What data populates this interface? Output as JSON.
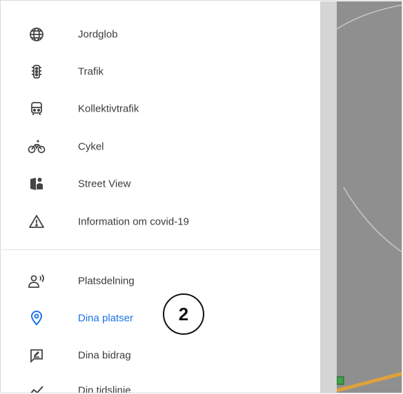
{
  "menu": {
    "items": [
      {
        "label": "Jordglob",
        "icon": "globe-icon"
      },
      {
        "label": "Trafik",
        "icon": "traffic-light-icon"
      },
      {
        "label": "Kollektivtrafik",
        "icon": "transit-icon"
      },
      {
        "label": "Cykel",
        "icon": "bicycle-icon"
      },
      {
        "label": "Street View",
        "icon": "street-view-icon"
      },
      {
        "label": "Information om covid-19",
        "icon": "warning-icon"
      },
      {
        "label": "Platsdelning",
        "icon": "location-sharing-icon"
      },
      {
        "label": "Dina platser",
        "icon": "place-pin-icon",
        "active": true
      },
      {
        "label": "Dina bidrag",
        "icon": "contributions-icon"
      },
      {
        "label": "Din tidslinje",
        "icon": "timeline-icon"
      }
    ]
  },
  "callout": {
    "number": "2"
  },
  "colors": {
    "accent": "#1a73e8",
    "text": "#3c3c3c",
    "map": "#8f8f8f"
  }
}
